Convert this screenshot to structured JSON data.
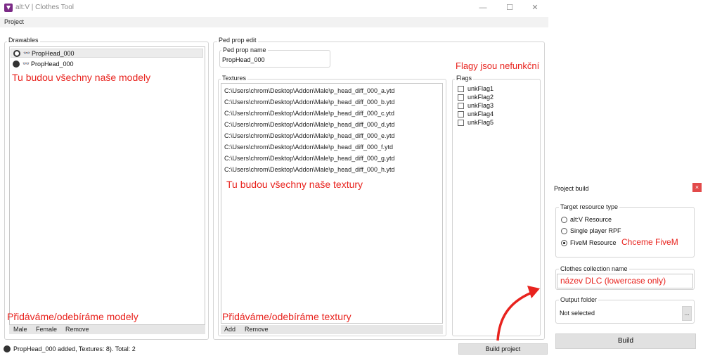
{
  "window": {
    "title": "alt:V | Clothes Tool",
    "minimize_glyph": "—",
    "maximize_glyph": "☐",
    "close_glyph": "✕"
  },
  "menu": {
    "project": "Project"
  },
  "drawables": {
    "label": "Drawables",
    "items": [
      {
        "label": "PropHead_000",
        "icon": "male-icon",
        "selected": true
      },
      {
        "label": "PropHead_000",
        "icon": "female-icon",
        "selected": false
      }
    ],
    "note_top": "Tu budou všechny naše modely",
    "note_bottom": "Přidáváme/odebíráme modely",
    "actions": {
      "male": "Male",
      "female": "Female",
      "remove": "Remove"
    }
  },
  "ped_prop": {
    "label": "Ped prop edit",
    "name_label": "Ped prop name",
    "name_value": "PropHead_000",
    "flags_note": "Flagy jsou nefunkční",
    "textures": {
      "label": "Textures",
      "items": [
        "C:\\Users\\chrom\\Desktop\\Addon\\Male\\p_head_diff_000_a.ytd",
        "C:\\Users\\chrom\\Desktop\\Addon\\Male\\p_head_diff_000_b.ytd",
        "C:\\Users\\chrom\\Desktop\\Addon\\Male\\p_head_diff_000_c.ytd",
        "C:\\Users\\chrom\\Desktop\\Addon\\Male\\p_head_diff_000_d.ytd",
        "C:\\Users\\chrom\\Desktop\\Addon\\Male\\p_head_diff_000_e.ytd",
        "C:\\Users\\chrom\\Desktop\\Addon\\Male\\p_head_diff_000_f.ytd",
        "C:\\Users\\chrom\\Desktop\\Addon\\Male\\p_head_diff_000_g.ytd",
        "C:\\Users\\chrom\\Desktop\\Addon\\Male\\p_head_diff_000_h.ytd"
      ],
      "note_top": "Tu budou všechny naše textury",
      "note_bottom": "Přidáváme/odebíráme textury",
      "actions": {
        "add": "Add",
        "remove": "Remove"
      }
    },
    "flags": {
      "label": "Flags",
      "items": [
        "unkFlag1",
        "unkFlag2",
        "unkFlag3",
        "unkFlag4",
        "unkFlag5"
      ]
    }
  },
  "status": {
    "text": "PropHead_000 added, Textures: 8). Total: 2"
  },
  "build_project": "Build project",
  "dialog": {
    "title": "Project build",
    "close_glyph": "×",
    "target_label": "Target resource type",
    "options": [
      {
        "label": "alt:V Resource",
        "checked": false
      },
      {
        "label": "Single player RPF",
        "checked": false
      },
      {
        "label": "FiveM Resource",
        "checked": true
      }
    ],
    "option_note": "Chceme FiveM",
    "collection_label": "Clothes collection name",
    "collection_value": "název DLC (lowercase only)",
    "output_label": "Output folder",
    "output_value": "Not selected",
    "browse": "...",
    "build": "Build"
  },
  "colors": {
    "accent_red": "#e8231e",
    "brand_purple": "#7b2a86",
    "dialog_close": "#e24a4a"
  }
}
